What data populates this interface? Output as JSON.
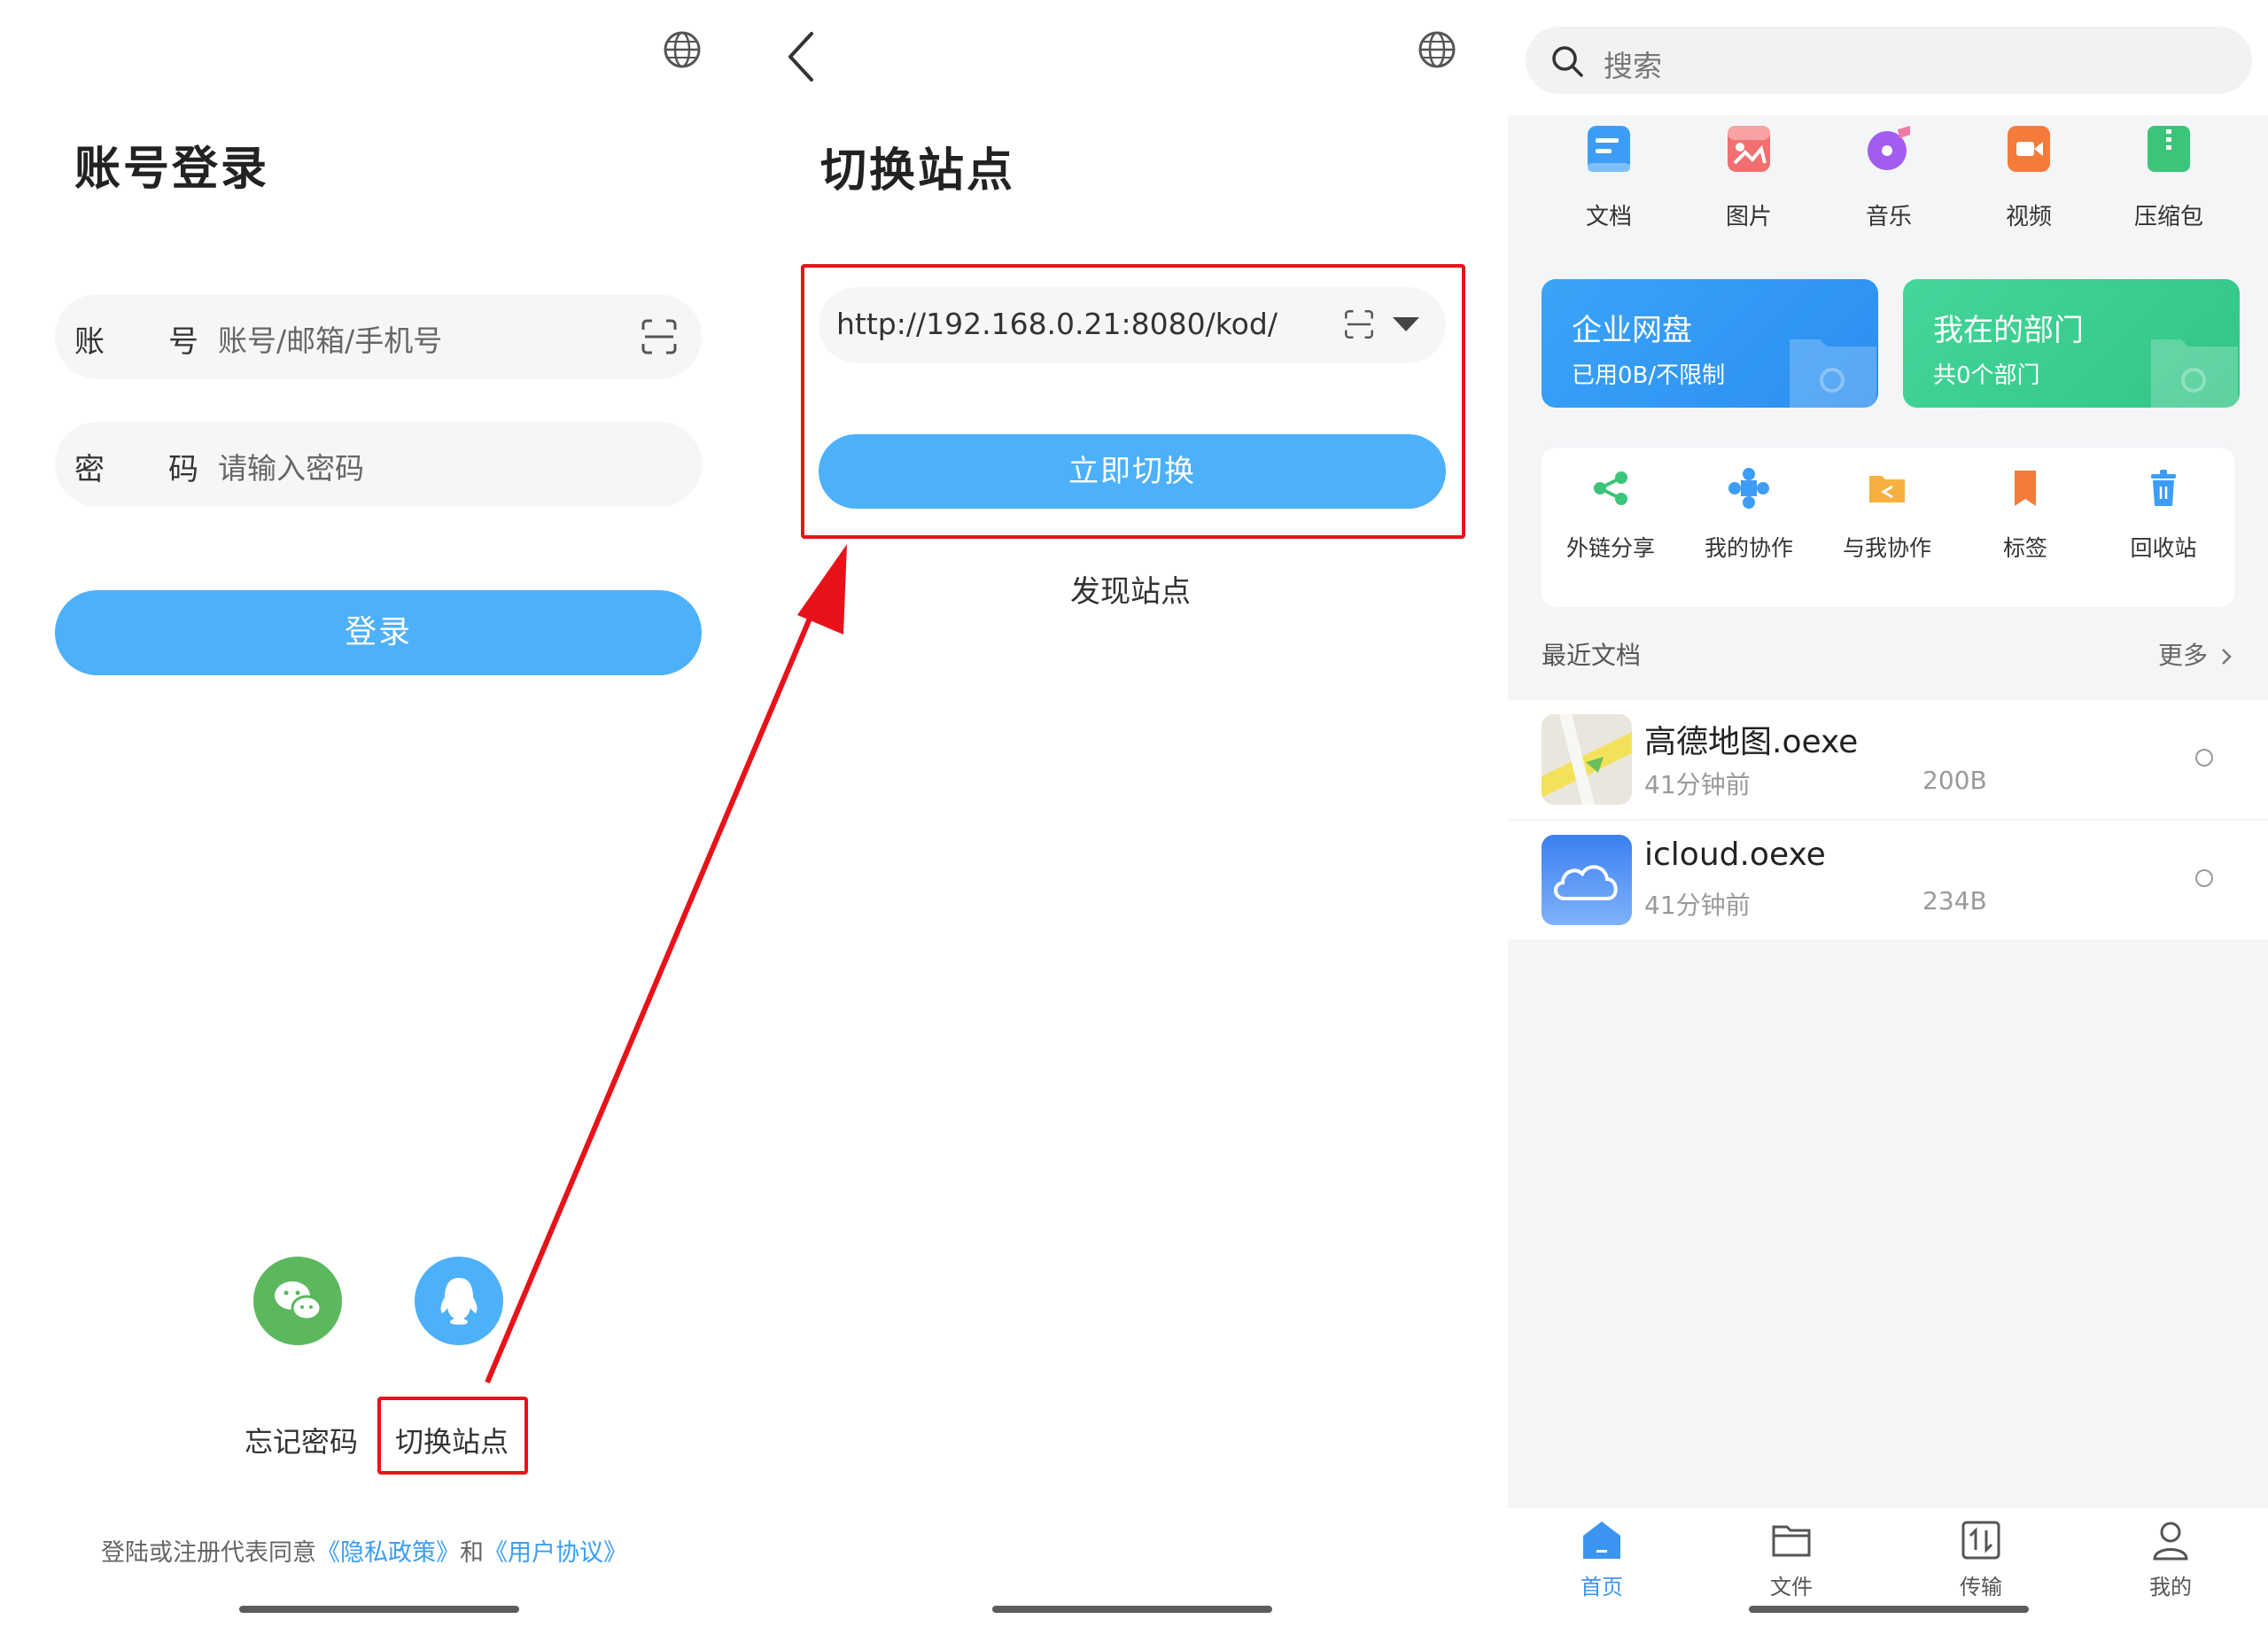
{
  "login": {
    "title": "账号登录",
    "account_label_1": "账",
    "account_label_2": "号",
    "account_placeholder": "账号/邮箱/手机号",
    "password_label_1": "密",
    "password_label_2": "码",
    "password_placeholder": "请输入密码",
    "login_button": "登录",
    "forgot_password": "忘记密码",
    "switch_site": "切换站点",
    "agreement_prefix": "登陆或注册代表同意",
    "privacy_policy": "《隐私政策》",
    "agreement_and": "和",
    "user_agreement": "《用户协议》",
    "icons": [
      "globe-icon",
      "scan-icon",
      "wechat-icon",
      "qq-icon"
    ]
  },
  "switch": {
    "title": "切换站点",
    "url_value": "http://192.168.0.21:8080/kod/",
    "switch_button": "立即切换",
    "discover": "发现站点",
    "icons": [
      "back-arrow-icon",
      "globe-icon",
      "scan-icon",
      "dropdown-triangle-icon"
    ]
  },
  "home": {
    "search_placeholder": "搜索",
    "categories": [
      {
        "label": "文档",
        "icon": "document-icon",
        "color": "#3d9df6"
      },
      {
        "label": "图片",
        "icon": "image-icon",
        "color": "#f26f6f"
      },
      {
        "label": "音乐",
        "icon": "music-icon",
        "color": "#a25cf0"
      },
      {
        "label": "视频",
        "icon": "video-icon",
        "color": "#f47b3a"
      },
      {
        "label": "压缩包",
        "icon": "archive-icon",
        "color": "#3cc57a"
      }
    ],
    "enterprise": {
      "title": "企业网盘",
      "subtitle": "已用0B/不限制"
    },
    "department": {
      "title": "我在的部门",
      "subtitle": "共0个部门"
    },
    "tools": [
      {
        "label": "外链分享",
        "icon": "share-link-icon"
      },
      {
        "label": "我的协作",
        "icon": "my-collab-icon"
      },
      {
        "label": "与我协作",
        "icon": "shared-with-me-icon"
      },
      {
        "label": "标签",
        "icon": "tag-icon"
      },
      {
        "label": "回收站",
        "icon": "recycle-bin-icon"
      }
    ],
    "recent_title": "最近文档",
    "more": "更多",
    "files": [
      {
        "name": "高德地图.oexe",
        "time": "41分钟前",
        "size": "200B",
        "icon": "map-app-icon"
      },
      {
        "name": "icloud.oexe",
        "time": "41分钟前",
        "size": "234B",
        "icon": "icloud-app-icon"
      }
    ],
    "tabs": [
      {
        "label": "首页",
        "icon": "home-icon",
        "active": true
      },
      {
        "label": "文件",
        "icon": "folder-icon",
        "active": false
      },
      {
        "label": "传输",
        "icon": "transfer-icon",
        "active": false
      },
      {
        "label": "我的",
        "icon": "user-icon",
        "active": false
      }
    ]
  },
  "colors": {
    "primary": "#4db0fa",
    "annotation": "#e8121a",
    "enterprise_card": "#2f9cf7",
    "department_card": "#3ccd8d",
    "tab_active": "#3b95f0"
  }
}
